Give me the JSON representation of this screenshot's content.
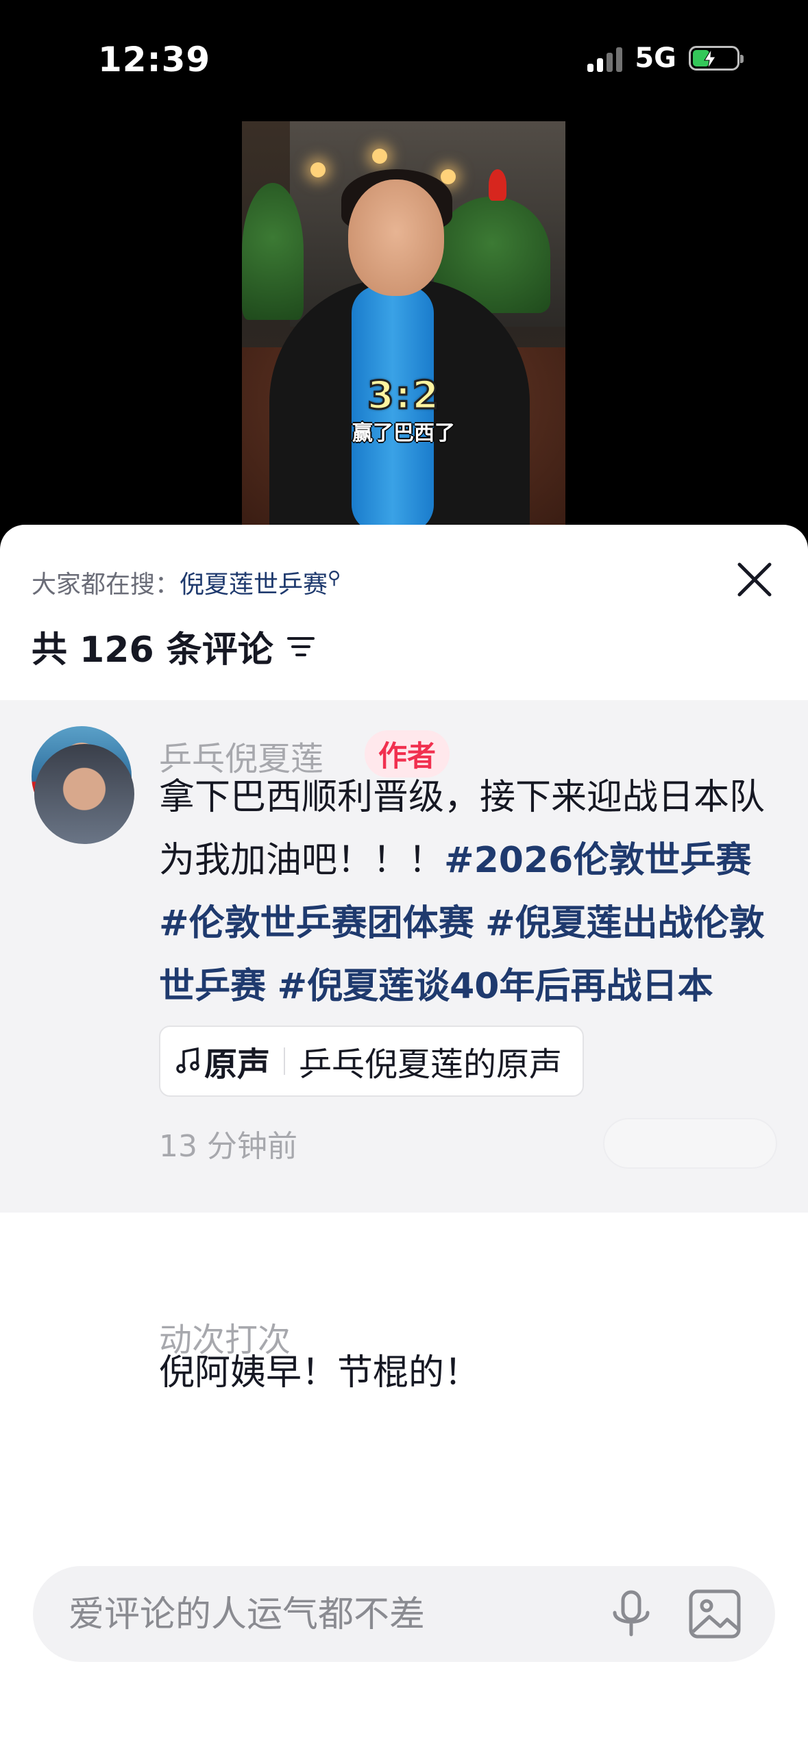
{
  "status_bar": {
    "time": "12:39",
    "network": "5G"
  },
  "video": {
    "score": "3:2",
    "caption": "赢了巴西了"
  },
  "comments_panel": {
    "search_prefix": "大家都在搜：",
    "search_keyword": "倪夏莲世乒赛",
    "count_title": "共 126 条评论",
    "comments": [
      {
        "author": "乒乓倪夏莲",
        "badge": "作者",
        "text_plain": "拿下巴西顺利晋级，接下来迎战日本队",
        "text_line2": "为我加油吧！！！",
        "hashtags": [
          "#2026伦敦世乒赛",
          "#伦敦世乒赛团体赛",
          "#倪夏莲出战伦敦世乒赛",
          "#倪夏莲谈40年后再战日本"
        ],
        "music_label": "原声",
        "music_title": "乒乓倪夏莲的原声",
        "time": "13 分钟前"
      },
      {
        "author": "动次打次",
        "text": "倪阿姨早！节棍的！"
      }
    ],
    "input_placeholder": "爱评论的人运气都不差"
  },
  "icons": [
    "signal-icon",
    "battery-icon",
    "search-icon",
    "close-icon",
    "sort-icon",
    "music-note-icon",
    "mic-icon",
    "image-icon"
  ],
  "colors": {
    "hashtag": "#1f3a6e",
    "author_badge_text": "#f1304f",
    "author_badge_bg": "#ffe8ec"
  }
}
